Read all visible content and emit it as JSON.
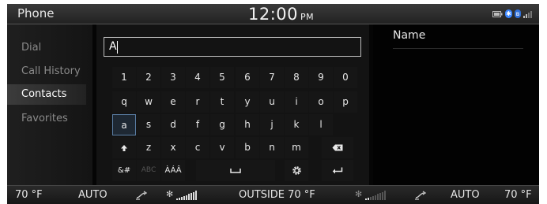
{
  "status_bar": {
    "title": "Phone",
    "time": "12:00",
    "ampm": "PM",
    "icons": [
      "battery-icon",
      "bluetooth-icon",
      "bluetooth-audio-icon",
      "signal-icon"
    ]
  },
  "sidebar": {
    "items": [
      {
        "label": "Dial",
        "active": false
      },
      {
        "label": "Call History",
        "active": false
      },
      {
        "label": "Contacts",
        "active": true
      },
      {
        "label": "Favorites",
        "active": false
      }
    ]
  },
  "search": {
    "value": "A"
  },
  "keyboard": {
    "row1": [
      "1",
      "2",
      "3",
      "4",
      "5",
      "6",
      "7",
      "8",
      "9",
      "0"
    ],
    "row2": [
      "q",
      "w",
      "e",
      "r",
      "t",
      "y",
      "u",
      "i",
      "o",
      "p"
    ],
    "row3": [
      "a",
      "s",
      "d",
      "f",
      "g",
      "h",
      "j",
      "k",
      "l"
    ],
    "row4": [
      "z",
      "x",
      "c",
      "v",
      "b",
      "n",
      "m"
    ],
    "mode_symbols": "&#",
    "mode_abc": "ABC",
    "mode_accents": "ÀÁÂ",
    "focused_key": "a"
  },
  "results": {
    "header": "Name"
  },
  "climate": {
    "left_temp": "70 °F",
    "left_mode": "AUTO",
    "outside": "OUTSIDE  70 °F",
    "right_mode": "AUTO",
    "right_temp": "70 °F"
  },
  "colors": {
    "focus_border": "#5b7fa6",
    "bluetooth": "#3a86ff"
  }
}
